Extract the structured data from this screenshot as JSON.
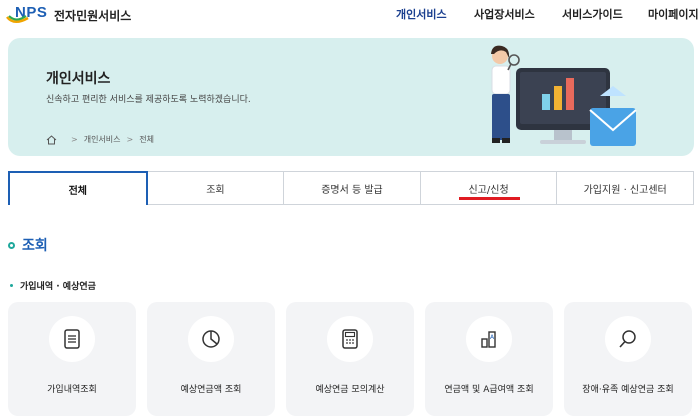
{
  "header": {
    "logo_text": "NPS",
    "site_name": "전자민원서비스",
    "nav": [
      "개인서비스",
      "사업장서비스",
      "서비스가이드",
      "마이페이지"
    ]
  },
  "banner": {
    "title": "개인서비스",
    "subtitle": "신속하고 편리한 서비스를 제공하도록 노력하겠습니다.",
    "breadcrumb": [
      "개인서비스",
      "전체"
    ]
  },
  "tabs": [
    "전체",
    "조회",
    "증명서 등 발급",
    "신고/신청",
    "가입지원 · 신고센터"
  ],
  "section": {
    "title": "조회",
    "subtitle": "가입내역 · 예상연금"
  },
  "cards": [
    {
      "label": "가입내역조회",
      "icon": "document-icon"
    },
    {
      "label": "예상연금액 조회",
      "icon": "pie-chart-icon"
    },
    {
      "label": "예상연금 모의계산",
      "icon": "calculator-icon"
    },
    {
      "label": "연금액 및 A급여액 조회",
      "icon": "bar-chart-icon"
    },
    {
      "label": "장애·유족 예상연금 조회",
      "icon": "magnifier-icon"
    }
  ],
  "colors": {
    "brand_blue": "#1d5fb4",
    "accent_teal": "#1fa89c",
    "banner_bg": "#d7efee",
    "active_underline": "#e01b22"
  }
}
